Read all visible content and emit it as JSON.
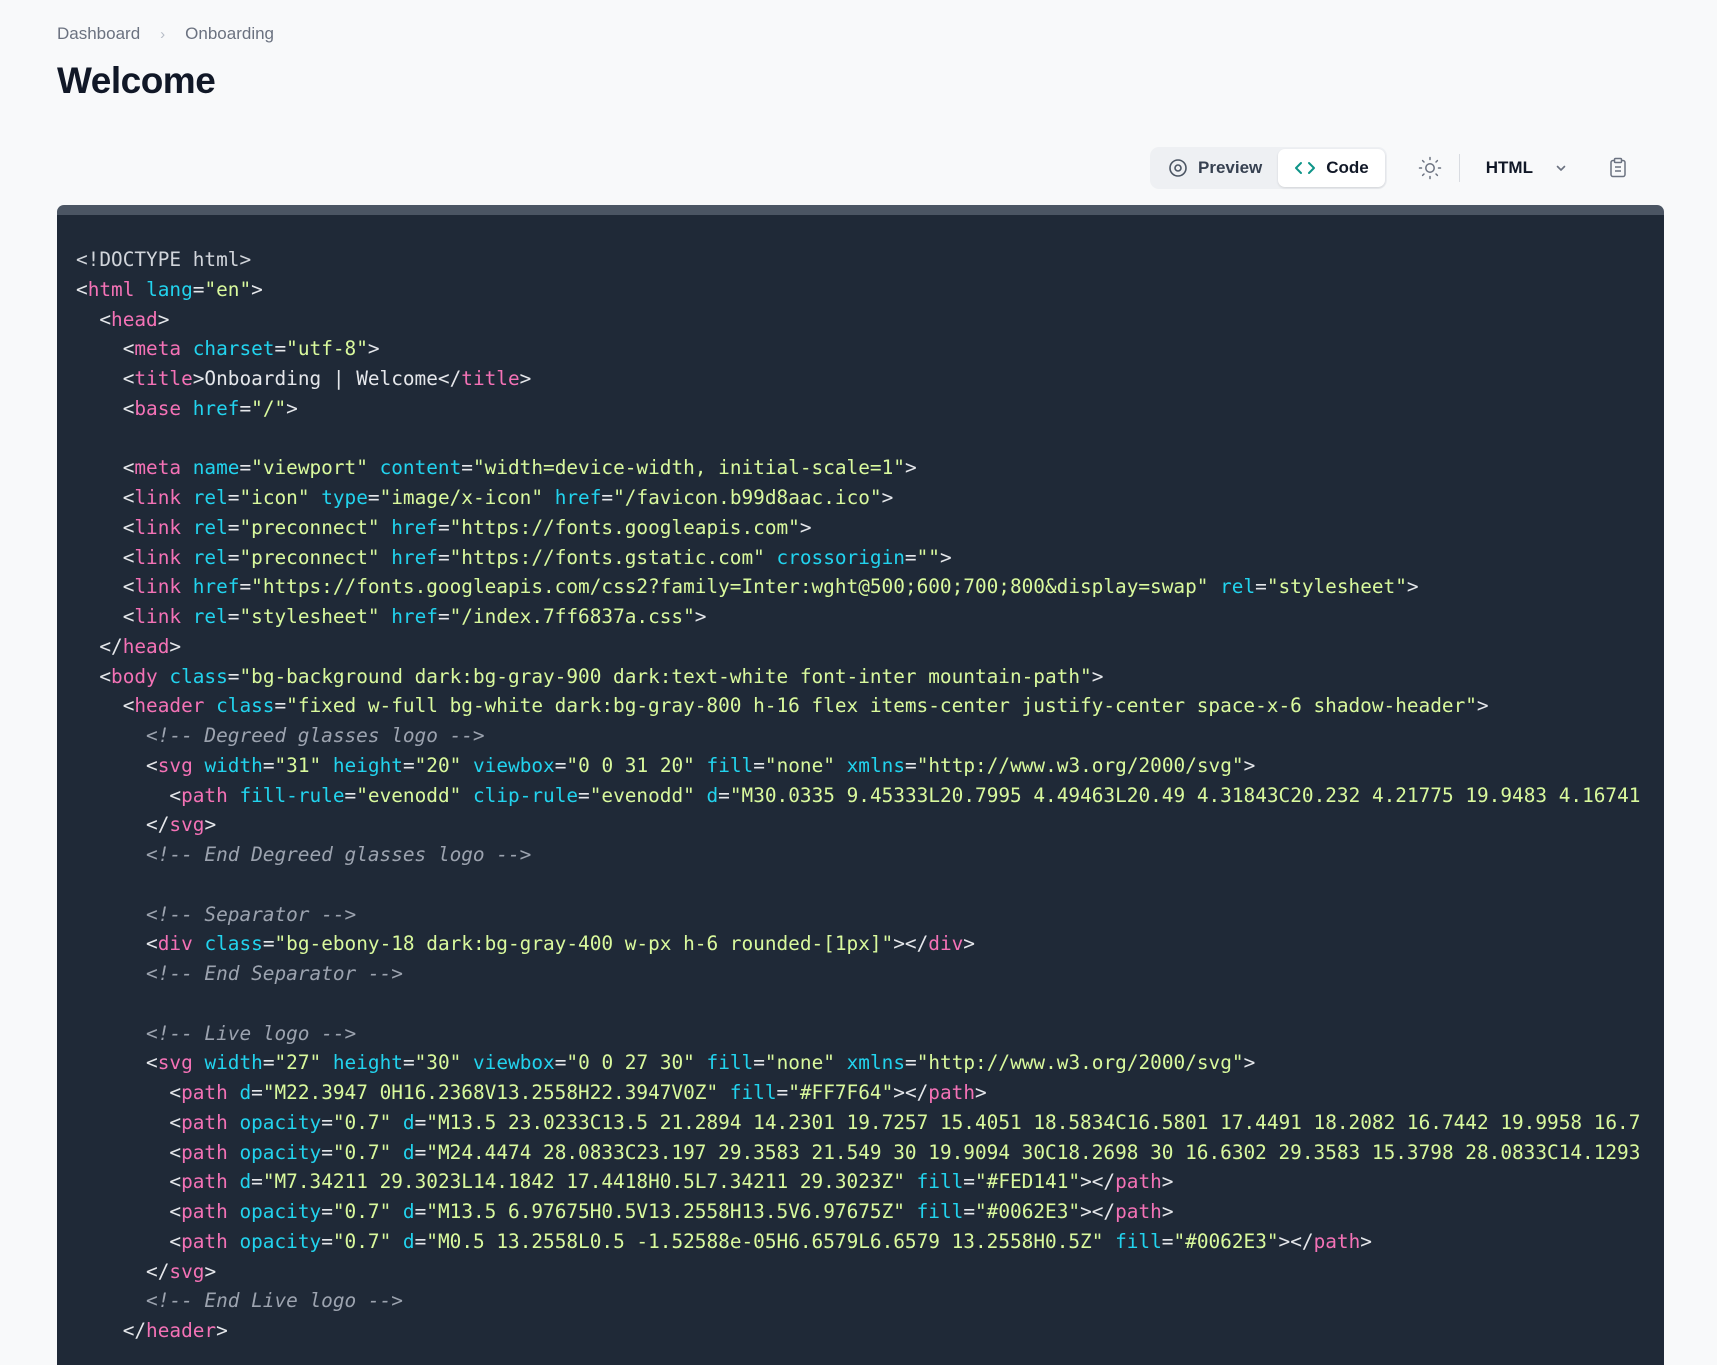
{
  "breadcrumb": {
    "items": [
      "Dashboard",
      "Onboarding"
    ],
    "separator": "›"
  },
  "page": {
    "title": "Welcome"
  },
  "toolbar": {
    "preview_label": "Preview",
    "code_label": "Code",
    "active_view": "Code",
    "language": "HTML",
    "icons": {
      "preview": "eye-icon",
      "code": "code-brackets-icon",
      "theme": "sun-icon",
      "language": "chevron-down-icon",
      "copy": "clipboard-icon"
    }
  },
  "colors": {
    "background": "#f8f9fa",
    "code_background": "#1f2937",
    "tag": "#f472b6",
    "attribute": "#22d3ee",
    "string": "#d9f99d",
    "comment": "#9ca3af"
  },
  "code": {
    "lines": [
      [
        [
          "p",
          "<!DOCTYPE html>"
        ]
      ],
      [
        [
          "p",
          "<"
        ],
        [
          "t",
          "html"
        ],
        [
          "a",
          " lang"
        ],
        [
          "p",
          "="
        ],
        [
          "s",
          "\"en\""
        ],
        [
          "p",
          ">"
        ]
      ],
      [
        [
          "p",
          "  <"
        ],
        [
          "t",
          "head"
        ],
        [
          "p",
          ">"
        ]
      ],
      [
        [
          "p",
          "    <"
        ],
        [
          "t",
          "meta"
        ],
        [
          "a",
          " charset"
        ],
        [
          "p",
          "="
        ],
        [
          "s",
          "\"utf-8\""
        ],
        [
          "p",
          ">"
        ]
      ],
      [
        [
          "p",
          "    <"
        ],
        [
          "t",
          "title"
        ],
        [
          "p",
          ">Onboarding | Welcome</"
        ],
        [
          "t",
          "title"
        ],
        [
          "p",
          ">"
        ]
      ],
      [
        [
          "p",
          "    <"
        ],
        [
          "t",
          "base"
        ],
        [
          "a",
          " href"
        ],
        [
          "p",
          "="
        ],
        [
          "s",
          "\"/\""
        ],
        [
          "p",
          ">"
        ]
      ],
      [],
      [
        [
          "p",
          "    <"
        ],
        [
          "t",
          "meta"
        ],
        [
          "a",
          " name"
        ],
        [
          "p",
          "="
        ],
        [
          "s",
          "\"viewport\""
        ],
        [
          "a",
          " content"
        ],
        [
          "p",
          "="
        ],
        [
          "s",
          "\"width=device-width, initial-scale=1\""
        ],
        [
          "p",
          ">"
        ]
      ],
      [
        [
          "p",
          "    <"
        ],
        [
          "t",
          "link"
        ],
        [
          "a",
          " rel"
        ],
        [
          "p",
          "="
        ],
        [
          "s",
          "\"icon\""
        ],
        [
          "a",
          " type"
        ],
        [
          "p",
          "="
        ],
        [
          "s",
          "\"image/x-icon\""
        ],
        [
          "a",
          " href"
        ],
        [
          "p",
          "="
        ],
        [
          "s",
          "\"/favicon.b99d8aac.ico\""
        ],
        [
          "p",
          ">"
        ]
      ],
      [
        [
          "p",
          "    <"
        ],
        [
          "t",
          "link"
        ],
        [
          "a",
          " rel"
        ],
        [
          "p",
          "="
        ],
        [
          "s",
          "\"preconnect\""
        ],
        [
          "a",
          " href"
        ],
        [
          "p",
          "="
        ],
        [
          "s",
          "\"https://fonts.googleapis.com\""
        ],
        [
          "p",
          ">"
        ]
      ],
      [
        [
          "p",
          "    <"
        ],
        [
          "t",
          "link"
        ],
        [
          "a",
          " rel"
        ],
        [
          "p",
          "="
        ],
        [
          "s",
          "\"preconnect\""
        ],
        [
          "a",
          " href"
        ],
        [
          "p",
          "="
        ],
        [
          "s",
          "\"https://fonts.gstatic.com\""
        ],
        [
          "a",
          " crossorigin"
        ],
        [
          "p",
          "="
        ],
        [
          "s",
          "\"\""
        ],
        [
          "p",
          ">"
        ]
      ],
      [
        [
          "p",
          "    <"
        ],
        [
          "t",
          "link"
        ],
        [
          "a",
          " href"
        ],
        [
          "p",
          "="
        ],
        [
          "s",
          "\"https://fonts.googleapis.com/css2?family=Inter:wght@500;600;700;800&display=swap\""
        ],
        [
          "a",
          " rel"
        ],
        [
          "p",
          "="
        ],
        [
          "s",
          "\"stylesheet\""
        ],
        [
          "p",
          ">"
        ]
      ],
      [
        [
          "p",
          "    <"
        ],
        [
          "t",
          "link"
        ],
        [
          "a",
          " rel"
        ],
        [
          "p",
          "="
        ],
        [
          "s",
          "\"stylesheet\""
        ],
        [
          "a",
          " href"
        ],
        [
          "p",
          "="
        ],
        [
          "s",
          "\"/index.7ff6837a.css\""
        ],
        [
          "p",
          ">"
        ]
      ],
      [
        [
          "p",
          "  </"
        ],
        [
          "t",
          "head"
        ],
        [
          "p",
          ">"
        ]
      ],
      [
        [
          "p",
          "  <"
        ],
        [
          "t",
          "body"
        ],
        [
          "a",
          " class"
        ],
        [
          "p",
          "="
        ],
        [
          "s",
          "\"bg-background dark:bg-gray-900 dark:text-white font-inter mountain-path\""
        ],
        [
          "p",
          ">"
        ]
      ],
      [
        [
          "p",
          "    <"
        ],
        [
          "t",
          "header"
        ],
        [
          "a",
          " class"
        ],
        [
          "p",
          "="
        ],
        [
          "s",
          "\"fixed w-full bg-white dark:bg-gray-800 h-16 flex items-center justify-center space-x-6 shadow-header\""
        ],
        [
          "p",
          ">"
        ]
      ],
      [
        [
          "c",
          "      <!-- Degreed glasses logo -->"
        ]
      ],
      [
        [
          "p",
          "      <"
        ],
        [
          "t",
          "svg"
        ],
        [
          "a",
          " width"
        ],
        [
          "p",
          "="
        ],
        [
          "s",
          "\"31\""
        ],
        [
          "a",
          " height"
        ],
        [
          "p",
          "="
        ],
        [
          "s",
          "\"20\""
        ],
        [
          "a",
          " viewbox"
        ],
        [
          "p",
          "="
        ],
        [
          "s",
          "\"0 0 31 20\""
        ],
        [
          "a",
          " fill"
        ],
        [
          "p",
          "="
        ],
        [
          "s",
          "\"none\""
        ],
        [
          "a",
          " xmlns"
        ],
        [
          "p",
          "="
        ],
        [
          "s",
          "\"http://www.w3.org/2000/svg\""
        ],
        [
          "p",
          ">"
        ]
      ],
      [
        [
          "p",
          "        <"
        ],
        [
          "t",
          "path"
        ],
        [
          "a",
          " fill-rule"
        ],
        [
          "p",
          "="
        ],
        [
          "s",
          "\"evenodd\""
        ],
        [
          "a",
          " clip-rule"
        ],
        [
          "p",
          "="
        ],
        [
          "s",
          "\"evenodd\""
        ],
        [
          "a",
          " d"
        ],
        [
          "p",
          "="
        ],
        [
          "s",
          "\"M30.0335 9.45333L20.7995 4.49463L20.49 4.31843C20.232 4.21775 19.9483 4.16741"
        ]
      ],
      [
        [
          "p",
          "      </"
        ],
        [
          "t",
          "svg"
        ],
        [
          "p",
          ">"
        ]
      ],
      [
        [
          "c",
          "      <!-- End Degreed glasses logo -->"
        ]
      ],
      [],
      [
        [
          "c",
          "      <!-- Separator -->"
        ]
      ],
      [
        [
          "p",
          "      <"
        ],
        [
          "t",
          "div"
        ],
        [
          "a",
          " class"
        ],
        [
          "p",
          "="
        ],
        [
          "s",
          "\"bg-ebony-18 dark:bg-gray-400 w-px h-6 rounded-[1px]\""
        ],
        [
          "p",
          "></"
        ],
        [
          "t",
          "div"
        ],
        [
          "p",
          ">"
        ]
      ],
      [
        [
          "c",
          "      <!-- End Separator -->"
        ]
      ],
      [],
      [
        [
          "c",
          "      <!-- Live logo -->"
        ]
      ],
      [
        [
          "p",
          "      <"
        ],
        [
          "t",
          "svg"
        ],
        [
          "a",
          " width"
        ],
        [
          "p",
          "="
        ],
        [
          "s",
          "\"27\""
        ],
        [
          "a",
          " height"
        ],
        [
          "p",
          "="
        ],
        [
          "s",
          "\"30\""
        ],
        [
          "a",
          " viewbox"
        ],
        [
          "p",
          "="
        ],
        [
          "s",
          "\"0 0 27 30\""
        ],
        [
          "a",
          " fill"
        ],
        [
          "p",
          "="
        ],
        [
          "s",
          "\"none\""
        ],
        [
          "a",
          " xmlns"
        ],
        [
          "p",
          "="
        ],
        [
          "s",
          "\"http://www.w3.org/2000/svg\""
        ],
        [
          "p",
          ">"
        ]
      ],
      [
        [
          "p",
          "        <"
        ],
        [
          "t",
          "path"
        ],
        [
          "a",
          " d"
        ],
        [
          "p",
          "="
        ],
        [
          "s",
          "\"M22.3947 0H16.2368V13.2558H22.3947V0Z\""
        ],
        [
          "a",
          " fill"
        ],
        [
          "p",
          "="
        ],
        [
          "s",
          "\"#FF7F64\""
        ],
        [
          "p",
          "></"
        ],
        [
          "t",
          "path"
        ],
        [
          "p",
          ">"
        ]
      ],
      [
        [
          "p",
          "        <"
        ],
        [
          "t",
          "path"
        ],
        [
          "a",
          " opacity"
        ],
        [
          "p",
          "="
        ],
        [
          "s",
          "\"0.7\""
        ],
        [
          "a",
          " d"
        ],
        [
          "p",
          "="
        ],
        [
          "s",
          "\"M13.5 23.0233C13.5 21.2894 14.2301 19.7257 15.4051 18.5834C16.5801 17.4491 18.2082 16.7442 19.9958 16.7"
        ]
      ],
      [
        [
          "p",
          "        <"
        ],
        [
          "t",
          "path"
        ],
        [
          "a",
          " opacity"
        ],
        [
          "p",
          "="
        ],
        [
          "s",
          "\"0.7\""
        ],
        [
          "a",
          " d"
        ],
        [
          "p",
          "="
        ],
        [
          "s",
          "\"M24.4474 28.0833C23.197 29.3583 21.549 30 19.9094 30C18.2698 30 16.6302 29.3583 15.3798 28.0833C14.1293"
        ]
      ],
      [
        [
          "p",
          "        <"
        ],
        [
          "t",
          "path"
        ],
        [
          "a",
          " d"
        ],
        [
          "p",
          "="
        ],
        [
          "s",
          "\"M7.34211 29.3023L14.1842 17.4418H0.5L7.34211 29.3023Z\""
        ],
        [
          "a",
          " fill"
        ],
        [
          "p",
          "="
        ],
        [
          "s",
          "\"#FED141\""
        ],
        [
          "p",
          "></"
        ],
        [
          "t",
          "path"
        ],
        [
          "p",
          ">"
        ]
      ],
      [
        [
          "p",
          "        <"
        ],
        [
          "t",
          "path"
        ],
        [
          "a",
          " opacity"
        ],
        [
          "p",
          "="
        ],
        [
          "s",
          "\"0.7\""
        ],
        [
          "a",
          " d"
        ],
        [
          "p",
          "="
        ],
        [
          "s",
          "\"M13.5 6.97675H0.5V13.2558H13.5V6.97675Z\""
        ],
        [
          "a",
          " fill"
        ],
        [
          "p",
          "="
        ],
        [
          "s",
          "\"#0062E3\""
        ],
        [
          "p",
          "></"
        ],
        [
          "t",
          "path"
        ],
        [
          "p",
          ">"
        ]
      ],
      [
        [
          "p",
          "        <"
        ],
        [
          "t",
          "path"
        ],
        [
          "a",
          " opacity"
        ],
        [
          "p",
          "="
        ],
        [
          "s",
          "\"0.7\""
        ],
        [
          "a",
          " d"
        ],
        [
          "p",
          "="
        ],
        [
          "s",
          "\"M0.5 13.2558L0.5 -1.52588e-05H6.6579L6.6579 13.2558H0.5Z\""
        ],
        [
          "a",
          " fill"
        ],
        [
          "p",
          "="
        ],
        [
          "s",
          "\"#0062E3\""
        ],
        [
          "p",
          "></"
        ],
        [
          "t",
          "path"
        ],
        [
          "p",
          ">"
        ]
      ],
      [
        [
          "p",
          "      </"
        ],
        [
          "t",
          "svg"
        ],
        [
          "p",
          ">"
        ]
      ],
      [
        [
          "c",
          "      <!-- End Live logo -->"
        ]
      ],
      [
        [
          "p",
          "    </"
        ],
        [
          "t",
          "header"
        ],
        [
          "p",
          ">"
        ]
      ]
    ]
  }
}
